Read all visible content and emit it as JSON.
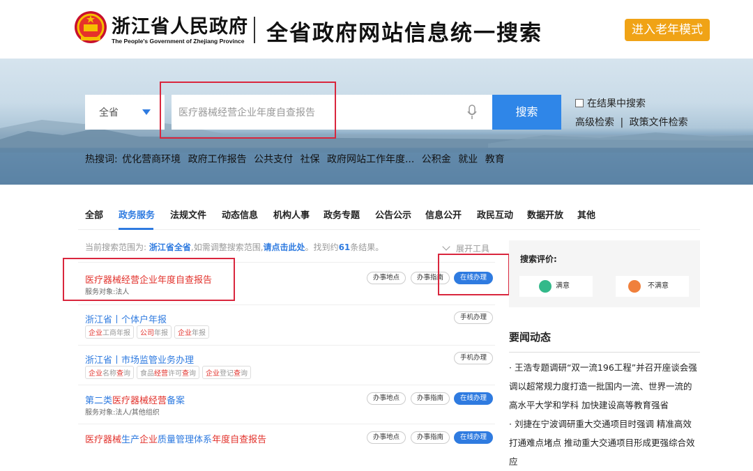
{
  "header": {
    "gov_name": "浙江省人民政府",
    "gov_name_en": "The People's Government of Zhejiang Province",
    "site_title": "全省政府网站信息统一搜索",
    "elder_mode": "进入老年模式"
  },
  "search": {
    "scope": "全省",
    "query": "医疗器械经营企业年度自查报告",
    "button": "搜索",
    "in_results": "在结果中搜索",
    "advanced": "高级检索",
    "separator": "|",
    "policy": "政策文件检索"
  },
  "hot": {
    "label": "热搜词:",
    "terms": [
      "优化营商环境",
      "政府工作报告",
      "公共支付",
      "社保",
      "政府网站工作年度...",
      "公积金",
      "就业",
      "教育"
    ]
  },
  "tabs": [
    "全部",
    "政务服务",
    "法规文件",
    "动态信息",
    "机构人事",
    "政务专题",
    "公告公示",
    "信息公开",
    "政民互动",
    "数据开放",
    "其他"
  ],
  "scope_line": {
    "prefix": "当前搜索范围为:",
    "scope": "浙江省全省",
    "mid": ",如需调整搜索范围,",
    "link": "请点击此处",
    "found": "。找到约",
    "count": "61",
    "suffix": "条结果。",
    "expand": "展开工具"
  },
  "results": [
    {
      "title": "医疗器械经营企业年度自查报告",
      "sub": "服务对象:法人",
      "pills": [
        "办事地点",
        "办事指南",
        "在线办理"
      ]
    },
    {
      "title": "浙江省丨个体户年报",
      "tags": [
        [
          "企业",
          "工商年报"
        ],
        [
          "公司",
          "年报"
        ],
        [
          "企业",
          "年报"
        ]
      ],
      "pills": [
        "手机办理"
      ]
    },
    {
      "title": "浙江省丨市场监管业务办理",
      "tags": [
        [
          "企业",
          "名称",
          "查",
          "询"
        ],
        [
          "食品",
          "经营",
          "许可",
          "查",
          "询"
        ],
        [
          "企业",
          "登记",
          "查",
          "询"
        ]
      ],
      "pills": [
        "手机办理"
      ]
    },
    {
      "title_pre": "第二类",
      "title_red": "医疗器械经营",
      "title_post": "备案",
      "sub": "服务对象:法人/其他组织",
      "pills": [
        "办事地点",
        "办事指南",
        "在线办理"
      ]
    },
    {
      "title_a": "医疗器械",
      "title_b": "生产",
      "title_c": "企业",
      "title_d": "质量管理体系",
      "title_e": "年度自查报告",
      "pills": [
        "办事地点",
        "办事指南",
        "在线办理"
      ]
    }
  ],
  "sidebar": {
    "rating_label": "搜索评价:",
    "good": "满意",
    "bad": "不满意",
    "news_title": "要闻动态",
    "news": [
      "王浩专题调研“双一流196工程”并召开座谈会强调以超常规力度打造一批国内一流、世界一流的高水平大学和学科 加快建设高等教育强省",
      "刘捷在宁波调研重大交通项目时强调 精准高效打通难点堵点 推动重大交通项目形成更强综合效应"
    ]
  },
  "colors": {
    "accent": "#2f7be0",
    "red": "#e2312b",
    "orange": "#f0a316"
  }
}
